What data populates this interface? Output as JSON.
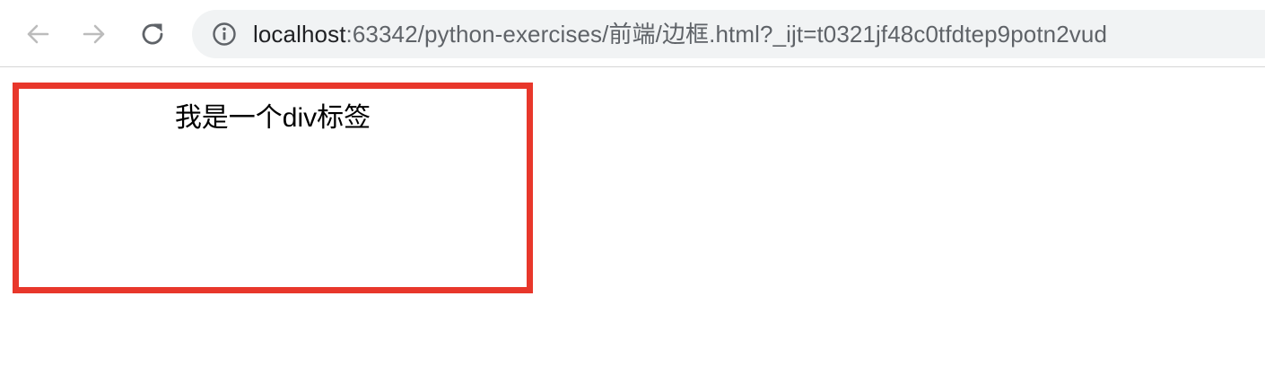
{
  "browser": {
    "icons": {
      "back": "arrow-left-icon",
      "forward": "arrow-right-icon",
      "reload": "reload-icon",
      "site_info": "info-icon"
    },
    "address_bar": {
      "host": "localhost",
      "path": ":63342/python-exercises/前端/边框.html?_ijt=t0321jf48c0tfdtep9potn2vud"
    }
  },
  "page": {
    "div_text": "我是一个div标签",
    "border_color": "#e8372b"
  }
}
